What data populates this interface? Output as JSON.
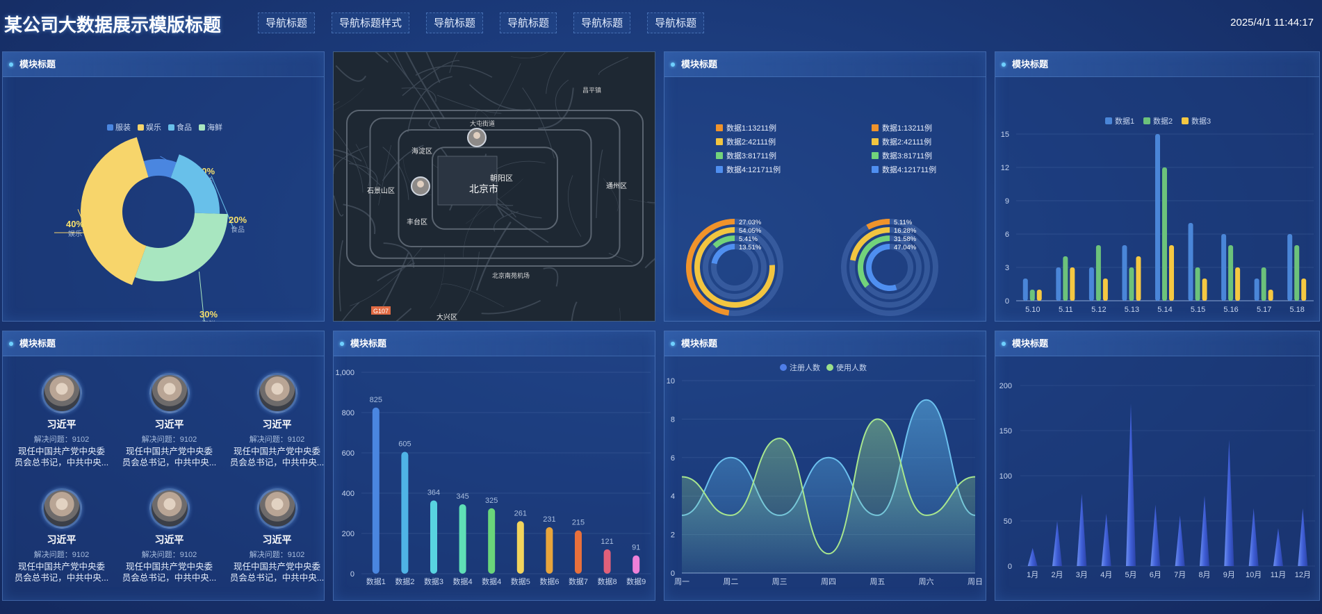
{
  "header": {
    "title": "某公司大数据展示模版标题",
    "nav": [
      "导航标题",
      "导航标题样式",
      "导航标题",
      "导航标题",
      "导航标题",
      "导航标题"
    ],
    "datetime": "2025/4/1 11:44:17"
  },
  "panels": {
    "p1": "模块标题",
    "p3": "模块标题",
    "p4": "模块标题",
    "p5": "模块标题",
    "p6": "模块标题",
    "p7": "模块标题",
    "p8": "模块标题"
  },
  "colors": {
    "blue": "#4a86e0",
    "yellow": "#f7d56b",
    "sky": "#68c0ea",
    "mint": "#a8e6c0",
    "green": "#72d37b",
    "orange": "#f0932b"
  },
  "map": {
    "labels": [
      "海淀区",
      "北京市",
      "朝阳区",
      "石景山区",
      "丰台区",
      "大兴区",
      "通州区",
      "昌平镇",
      "大屯街道",
      "北京南苑机场",
      "G107"
    ]
  },
  "chart_data": [
    {
      "type": "pie",
      "legend": [
        "服装",
        "娱乐",
        "食品",
        "海鲜"
      ],
      "slices": [
        {
          "name": "服装",
          "value": 10,
          "label": "10%"
        },
        {
          "name": "食品",
          "value": 20,
          "label": "20%"
        },
        {
          "name": "海鲜",
          "value": 30,
          "label": "30%"
        },
        {
          "name": "娱乐",
          "value": 40,
          "label": "40%"
        }
      ]
    },
    {
      "type": "radial-bar",
      "legend_left": [
        "数据1:13211例",
        "数据2:42111例",
        "数据3:81711例",
        "数据4:121711例"
      ],
      "legend_right": [
        "数据1:13211例",
        "数据2:42111例",
        "数据3:81711例",
        "数据4:121711例"
      ],
      "ring_left": [
        "27.03%",
        "54.05%",
        "5.41%",
        "13.51%"
      ],
      "ring_right": [
        "5.11%",
        "16.28%",
        "31.58%",
        "47.04%"
      ]
    },
    {
      "type": "bar",
      "legend": [
        "数据1",
        "数据2",
        "数据3"
      ],
      "categories": [
        "5.10",
        "5.11",
        "5.12",
        "5.13",
        "5.14",
        "5.15",
        "5.16",
        "5.17",
        "5.18"
      ],
      "ylim": [
        0,
        15
      ],
      "yticks": [
        "0",
        "3",
        "6",
        "9",
        "12",
        "15"
      ],
      "series": [
        {
          "name": "数据1",
          "values": [
            2,
            3,
            3,
            5,
            15,
            7,
            6,
            2,
            6
          ]
        },
        {
          "name": "数据2",
          "values": [
            1,
            4,
            5,
            3,
            12,
            3,
            5,
            3,
            5
          ]
        },
        {
          "name": "数据3",
          "values": [
            1,
            3,
            2,
            4,
            5,
            2,
            3,
            1,
            2
          ]
        }
      ]
    },
    {
      "type": "bar",
      "categories": [
        "数据1",
        "数据2",
        "数据3",
        "数据4",
        "数据4",
        "数据5",
        "数据6",
        "数据7",
        "数据8",
        "数据9"
      ],
      "values": [
        825,
        605,
        364,
        345,
        325,
        261,
        231,
        215,
        121,
        91
      ],
      "ylim": [
        0,
        1000
      ],
      "yticks": [
        "0",
        "200",
        "400",
        "600",
        "800",
        "1,000"
      ]
    },
    {
      "type": "area",
      "legend": [
        "注册人数",
        "使用人数"
      ],
      "categories": [
        "周一",
        "周二",
        "周三",
        "周四",
        "周五",
        "周六",
        "周日"
      ],
      "ylim": [
        0,
        10
      ],
      "yticks": [
        "0",
        "2",
        "4",
        "6",
        "8",
        "10"
      ],
      "series": [
        {
          "name": "注册人数",
          "values": [
            3,
            6,
            3,
            6,
            3,
            9,
            3
          ]
        },
        {
          "name": "使用人数",
          "values": [
            5,
            3,
            7,
            1,
            8,
            3,
            5
          ]
        }
      ]
    },
    {
      "type": "bar",
      "categories": [
        "1月",
        "2月",
        "3月",
        "4月",
        "5月",
        "6月",
        "7月",
        "8月",
        "9月",
        "10月",
        "11月",
        "12月"
      ],
      "values": [
        20,
        50,
        80,
        58,
        180,
        68,
        56,
        78,
        140,
        64,
        42,
        64
      ],
      "ylim": [
        0,
        200
      ],
      "yticks": [
        "0",
        "50",
        "100",
        "150",
        "200"
      ]
    }
  ],
  "people": [
    {
      "name": "习近平",
      "stat": "解决问题：9102",
      "desc1": "现任中国共产党中央委",
      "desc2": "员会总书记，中共中央..."
    },
    {
      "name": "习近平",
      "stat": "解决问题：9102",
      "desc1": "现任中国共产党中央委",
      "desc2": "员会总书记，中共中央..."
    },
    {
      "name": "习近平",
      "stat": "解决问题：9102",
      "desc1": "现任中国共产党中央委",
      "desc2": "员会总书记，中共中央..."
    },
    {
      "name": "习近平",
      "stat": "解决问题：9102",
      "desc1": "现任中国共产党中央委",
      "desc2": "员会总书记，中共中央..."
    },
    {
      "name": "习近平",
      "stat": "解决问题：9102",
      "desc1": "现任中国共产党中央委",
      "desc2": "员会总书记，中共中央..."
    },
    {
      "name": "习近平",
      "stat": "解决问题：9102",
      "desc1": "现任中国共产党中央委",
      "desc2": "员会总书记，中共中央..."
    }
  ]
}
